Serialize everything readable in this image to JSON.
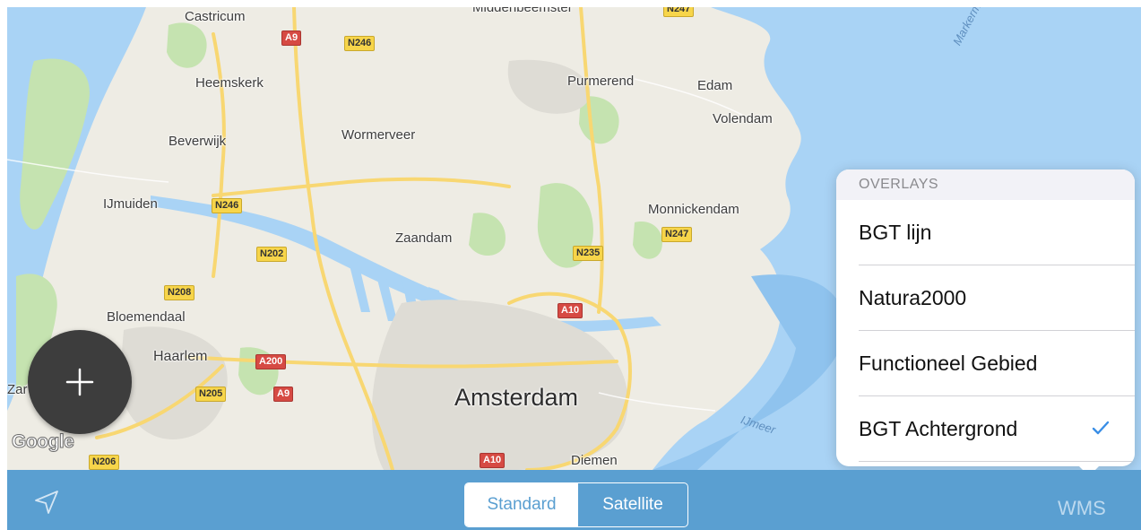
{
  "map": {
    "labels": {
      "castricum": "Castricum",
      "middenbeemster": "Middenbeemster",
      "heemskerk": "Heemskerk",
      "purmerend": "Purmerend",
      "edam": "Edam",
      "volendam": "Volendam",
      "beverwijk": "Beverwijk",
      "wormerveer": "Wormerveer",
      "ijmuiden": "IJmuiden",
      "monnickendam": "Monnickendam",
      "zaandam": "Zaandam",
      "bloemendaal": "Bloemendaal",
      "haarlem": "Haarlem",
      "zandvoort_partial": "Zar",
      "amsterdam": "Amsterdam",
      "diemen": "Diemen"
    },
    "water_labels": {
      "markermeer": "Markermeer",
      "ijmeer": "IJmeer"
    },
    "shields": {
      "a9_top": "A9",
      "n246_top": "N246",
      "n247_top": "N247",
      "n246_left": "N246",
      "n202": "N202",
      "n235": "N235",
      "n247_mid": "N247",
      "n208": "N208",
      "a10_mid": "A10",
      "a200": "A200",
      "n205": "N205",
      "a9_bottom": "A9",
      "n206": "N206",
      "a10_bottom": "A10"
    },
    "attribution": "Google",
    "colors": {
      "water": "#a9d3f5",
      "land": "#eeece4",
      "park": "#c5e3b0",
      "road": "#f8d772"
    }
  },
  "fab": {
    "icon": "plus-icon"
  },
  "toolbar": {
    "locate_icon": "location-arrow-icon",
    "map_types": [
      {
        "label": "Standard",
        "selected": true
      },
      {
        "label": "Satellite",
        "selected": false
      }
    ],
    "wms_label": "WMS",
    "color": "#5a9fd1"
  },
  "overlays": {
    "header": "OVERLAYS",
    "items": [
      {
        "label": "BGT lijn",
        "checked": false
      },
      {
        "label": "Natura2000",
        "checked": false
      },
      {
        "label": "Functioneel Gebied",
        "checked": false
      },
      {
        "label": "BGT Achtergrond",
        "checked": true
      }
    ],
    "check_color": "#3a8ee6"
  }
}
